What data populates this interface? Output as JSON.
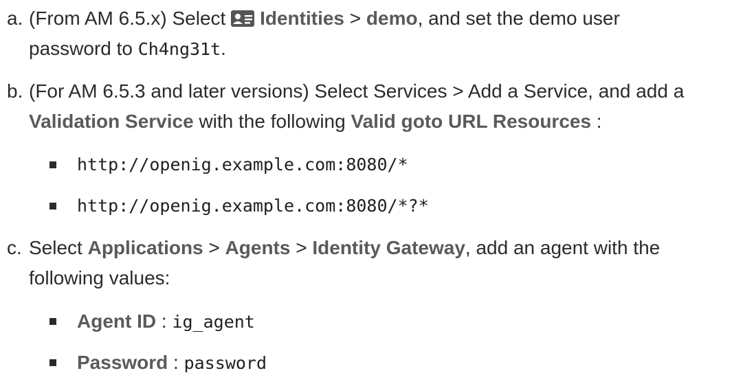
{
  "item_a": {
    "marker": "a.",
    "pre": "(From AM 6.5.x) Select ",
    "icon": "id-card-icon",
    "identities": "Identities",
    "sep": " > ",
    "demo": "demo",
    "mid": ", and set the demo user",
    "line2_pre": "password to ",
    "password": "Ch4ng31t",
    "end": "."
  },
  "item_b": {
    "marker": "b.",
    "line1": "(For AM 6.5.3 and later versions) Select Services > Add a Service, and add a",
    "validation": "Validation Service",
    "mid": " with the following ",
    "resources": "Valid goto URL Resources",
    "end": " :",
    "urls": [
      "http://openig.example.com:8080/*",
      "http://openig.example.com:8080/*?*"
    ]
  },
  "item_c": {
    "marker": "c.",
    "pre": "Select ",
    "applications": "Applications",
    "sep1": " > ",
    "agents": "Agents",
    "sep2": " > ",
    "gateway": "Identity Gateway",
    "end": ", add an agent with the",
    "line2": "following values:",
    "values": [
      {
        "label": "Agent ID",
        "colon": " : ",
        "value": "ig_agent"
      },
      {
        "label": "Password",
        "colon": " : ",
        "value": "password"
      }
    ]
  }
}
